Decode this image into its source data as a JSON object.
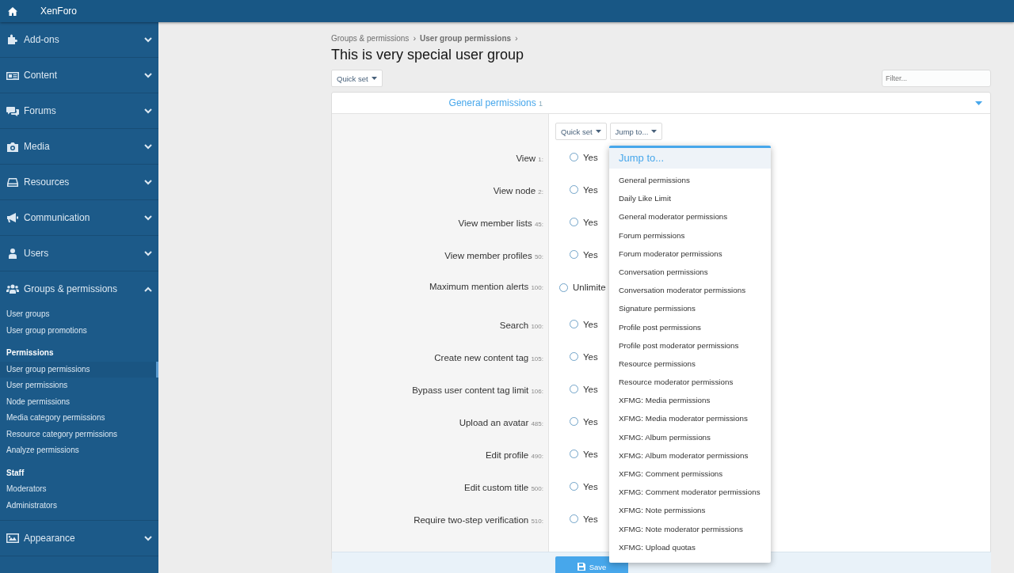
{
  "topbar": {
    "title": "XenForo"
  },
  "sidebar": {
    "sections": [
      {
        "label": "Add-ons",
        "expanded": false
      },
      {
        "label": "Content",
        "expanded": false
      },
      {
        "label": "Forums",
        "expanded": false
      },
      {
        "label": "Media",
        "expanded": false
      },
      {
        "label": "Resources",
        "expanded": false
      },
      {
        "label": "Communication",
        "expanded": false
      },
      {
        "label": "Users",
        "expanded": false
      },
      {
        "label": "Groups & permissions",
        "expanded": true,
        "items": [
          {
            "kind": "link",
            "label": "User groups",
            "selected": false
          },
          {
            "kind": "link",
            "label": "User group promotions",
            "selected": false
          },
          {
            "kind": "heading",
            "label": "Permissions"
          },
          {
            "kind": "link",
            "label": "User group permissions",
            "selected": true
          },
          {
            "kind": "link",
            "label": "User permissions",
            "selected": false
          },
          {
            "kind": "link",
            "label": "Node permissions",
            "selected": false
          },
          {
            "kind": "link",
            "label": "Media category permissions",
            "selected": false
          },
          {
            "kind": "link",
            "label": "Resource category permissions",
            "selected": false
          },
          {
            "kind": "link",
            "label": "Analyze permissions",
            "selected": false
          },
          {
            "kind": "heading",
            "label": "Staff"
          },
          {
            "kind": "link",
            "label": "Moderators",
            "selected": false
          },
          {
            "kind": "link",
            "label": "Administrators",
            "selected": false
          }
        ]
      },
      {
        "label": "Appearance",
        "expanded": false
      }
    ]
  },
  "breadcrumb": [
    {
      "label": "Groups & permissions",
      "current": false,
      "separator": "›"
    },
    {
      "label": "User group permissions",
      "current": true,
      "separator": "›"
    }
  ],
  "title": "This is very special user group",
  "quick_set": "Quick set",
  "filter": {
    "placeholder": "Filter..."
  },
  "block": {
    "title": "General permissions",
    "count": "1",
    "expanded": true,
    "buttons": [
      "Quick set",
      "Jump to..."
    ],
    "rows": [
      {
        "label": "View",
        "hint": "1:",
        "option": "Yes",
        "checked": false
      },
      {
        "label": "View node",
        "hint": "2:",
        "option": "Yes",
        "checked": false
      },
      {
        "label": "View member lists",
        "hint": "45:",
        "option": "Yes",
        "checked": false
      },
      {
        "label": "View member profiles",
        "hint": "50:",
        "option": "Yes",
        "checked": false
      },
      {
        "label": "Maximum mention alerts",
        "hint": "100:",
        "option": "Unlimite",
        "checked": false,
        "kind": "wide"
      },
      {
        "label": "Search",
        "hint": "100:",
        "option": "Yes",
        "checked": false
      },
      {
        "label": "Create new content tag",
        "hint": "105:",
        "option": "Yes",
        "checked": false
      },
      {
        "label": "Bypass user content tag limit",
        "hint": "106:",
        "option": "Yes",
        "checked": false
      },
      {
        "label": "Upload an avatar",
        "hint": "485:",
        "option": "Yes",
        "checked": false
      },
      {
        "label": "Edit profile",
        "hint": "490:",
        "option": "Yes",
        "checked": false
      },
      {
        "label": "Edit custom title",
        "hint": "500:",
        "option": "Yes",
        "checked": false
      },
      {
        "label": "Require two-step verification",
        "hint": "510:",
        "option": "Yes",
        "checked": false
      }
    ]
  },
  "jump_menu": {
    "title": "Jump to...",
    "items": [
      "General permissions",
      "Daily Like Limit",
      "General moderator permissions",
      "Forum permissions",
      "Forum moderator permissions",
      "Conversation permissions",
      "Conversation moderator permissions",
      "Signature permissions",
      "Profile post permissions",
      "Profile post moderator permissions",
      "Resource permissions",
      "Resource moderator permissions",
      "XFMG: Media permissions",
      "XFMG: Media moderator permissions",
      "XFMG: Album permissions",
      "XFMG: Album moderator permissions",
      "XFMG: Comment permissions",
      "XFMG: Comment moderator permissions",
      "XFMG: Note permissions",
      "XFMG: Note moderator permissions",
      "XFMG: Upload quotas"
    ]
  },
  "save_button": "Save"
}
